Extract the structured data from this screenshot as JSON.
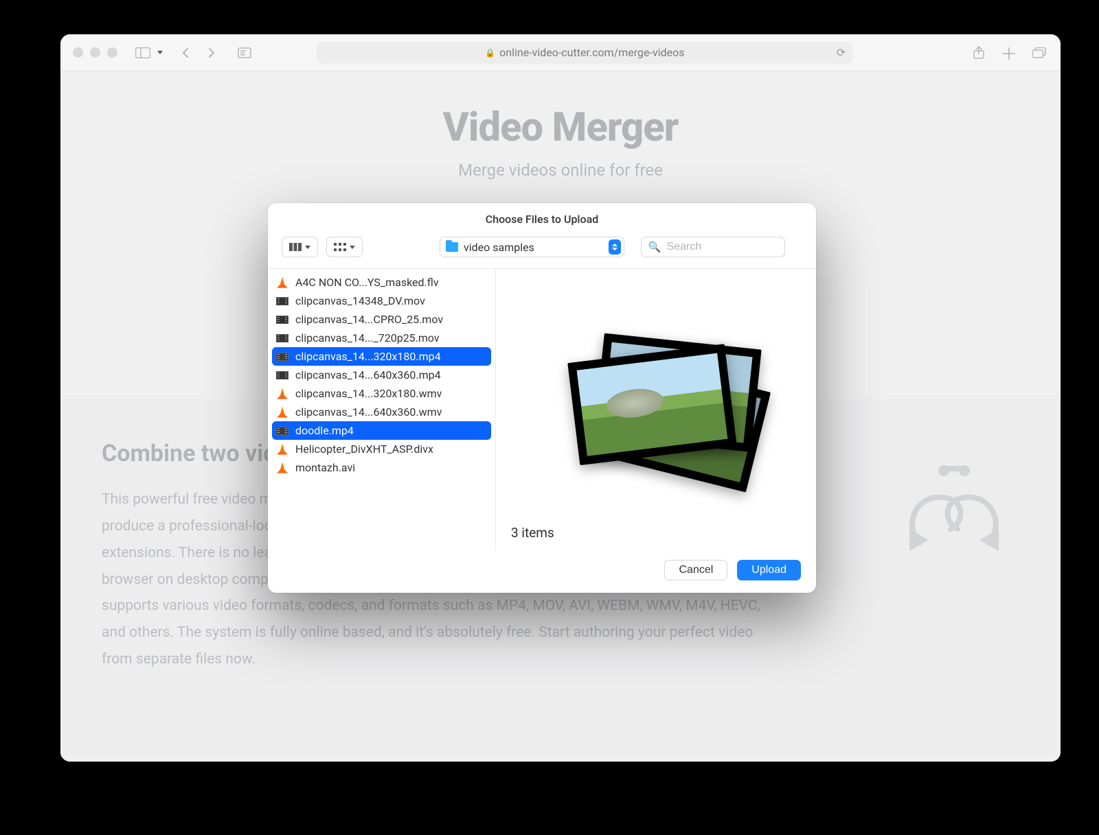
{
  "browser": {
    "url_display": "online-video-cutter.com/merge-videos"
  },
  "page": {
    "hero_title": "Video Merger",
    "hero_subtitle": "Merge videos online for free",
    "section_title": "Combine two videos",
    "section_body": "This powerful free video merger lets you combine as many video files into one project as you want, and produce a professional-looking video without the need for any additional software, codecs, or browser extensions. There is no learning curve, and the UI has every tool you need. This Video Merger works in a browser on desktop computers and mobile devices, such as smartphones or tablets. The platform supports various video formats, codecs, and formats such as MP4, MOV, AVI, WEBM, WMV, M4V, HEVC, and others. The system is fully online based, and it's absolutely free. Start authoring your perfect video from separate files now."
  },
  "dialog": {
    "title": "Choose Files to Upload",
    "location": "video samples",
    "search_placeholder": "Search",
    "item_count_label": "3 items",
    "cancel_label": "Cancel",
    "upload_label": "Upload",
    "files": [
      {
        "name": "A4C NON CO...YS_masked.flv",
        "icon": "vlc",
        "selected": false
      },
      {
        "name": "clipcanvas_14348_DV.mov",
        "icon": "vid",
        "selected": false
      },
      {
        "name": "clipcanvas_14...CPRO_25.mov",
        "icon": "vid",
        "selected": false
      },
      {
        "name": "clipcanvas_14..._720p25.mov",
        "icon": "vid",
        "selected": false
      },
      {
        "name": "clipcanvas_14...320x180.mp4",
        "icon": "vid",
        "selected": true
      },
      {
        "name": "clipcanvas_14...640x360.mp4",
        "icon": "vid",
        "selected": false
      },
      {
        "name": "clipcanvas_14...320x180.wmv",
        "icon": "vlc",
        "selected": false
      },
      {
        "name": "clipcanvas_14...640x360.wmv",
        "icon": "vlc",
        "selected": false
      },
      {
        "name": "doodle.mp4",
        "icon": "vid",
        "selected": true
      },
      {
        "name": "Helicopter_DivXHT_ASP.divx",
        "icon": "vlc",
        "selected": false
      },
      {
        "name": "montazh.avi",
        "icon": "vlc",
        "selected": false
      }
    ]
  }
}
